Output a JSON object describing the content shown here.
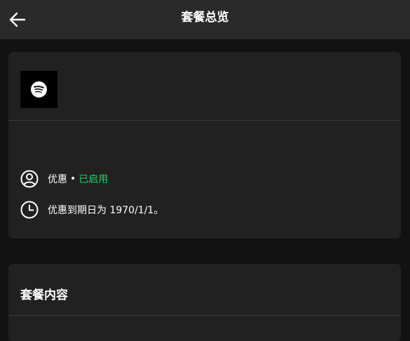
{
  "header": {
    "title": "套餐总览",
    "back_icon": "arrow-left-icon"
  },
  "plan_card": {
    "logo_icon": "spotify-logo-icon",
    "offer_label": "优惠",
    "separator": "•",
    "offer_status": "已启用",
    "expiry_text": "优惠到期日为 1970/1/1。",
    "status_color": "#1ed760"
  },
  "contents_card": {
    "title": "套餐内容"
  }
}
